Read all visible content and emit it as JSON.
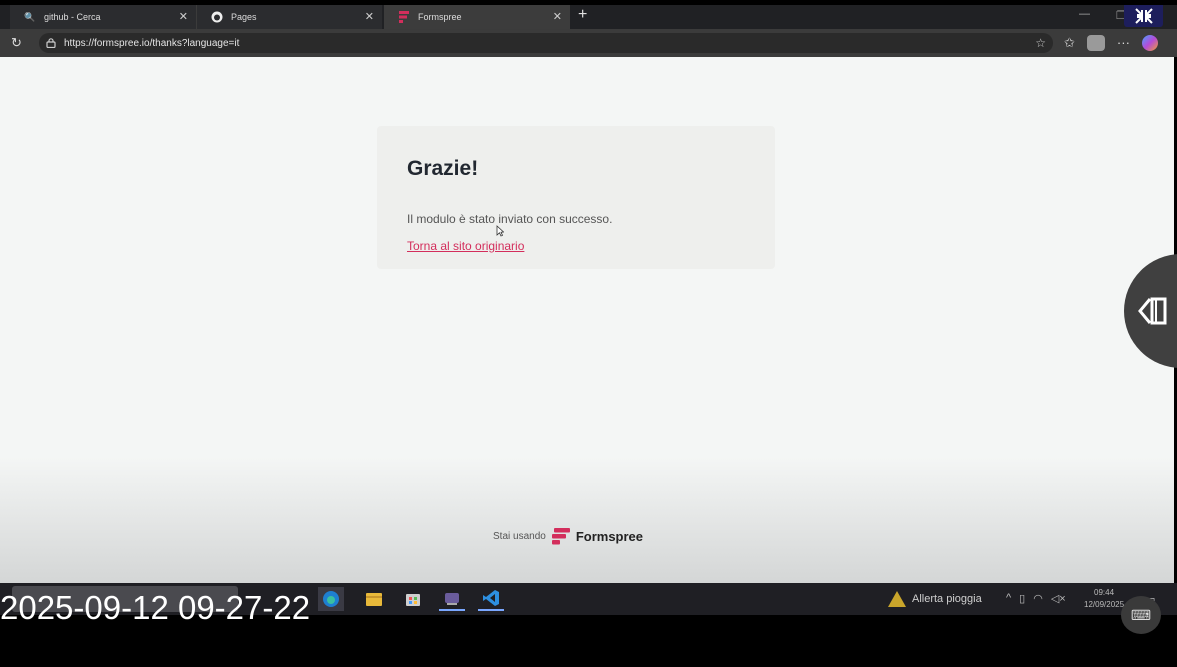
{
  "browser": {
    "tabs": [
      {
        "label": "github - Cerca",
        "icon": "search-icon"
      },
      {
        "label": "Pages",
        "icon": "github-icon"
      },
      {
        "label": "Formspree",
        "icon": "formspree-icon",
        "active": true
      }
    ],
    "new_tab_label": "+",
    "url": "https://formspree.io/thanks?language=it"
  },
  "page": {
    "heading": "Grazie!",
    "message": "Il modulo è stato inviato con successo.",
    "back_link": "Torna al sito originario",
    "footer_prefix": "Stai usando",
    "footer_brand": "Formspree",
    "accent_color": "#d32e5c"
  },
  "taskbar": {
    "weather_text": "Allerta pioggia",
    "time": "09:44",
    "date": "12/09/2025"
  },
  "overlay": {
    "timestamp": "2025-09-12 09-27-22"
  }
}
